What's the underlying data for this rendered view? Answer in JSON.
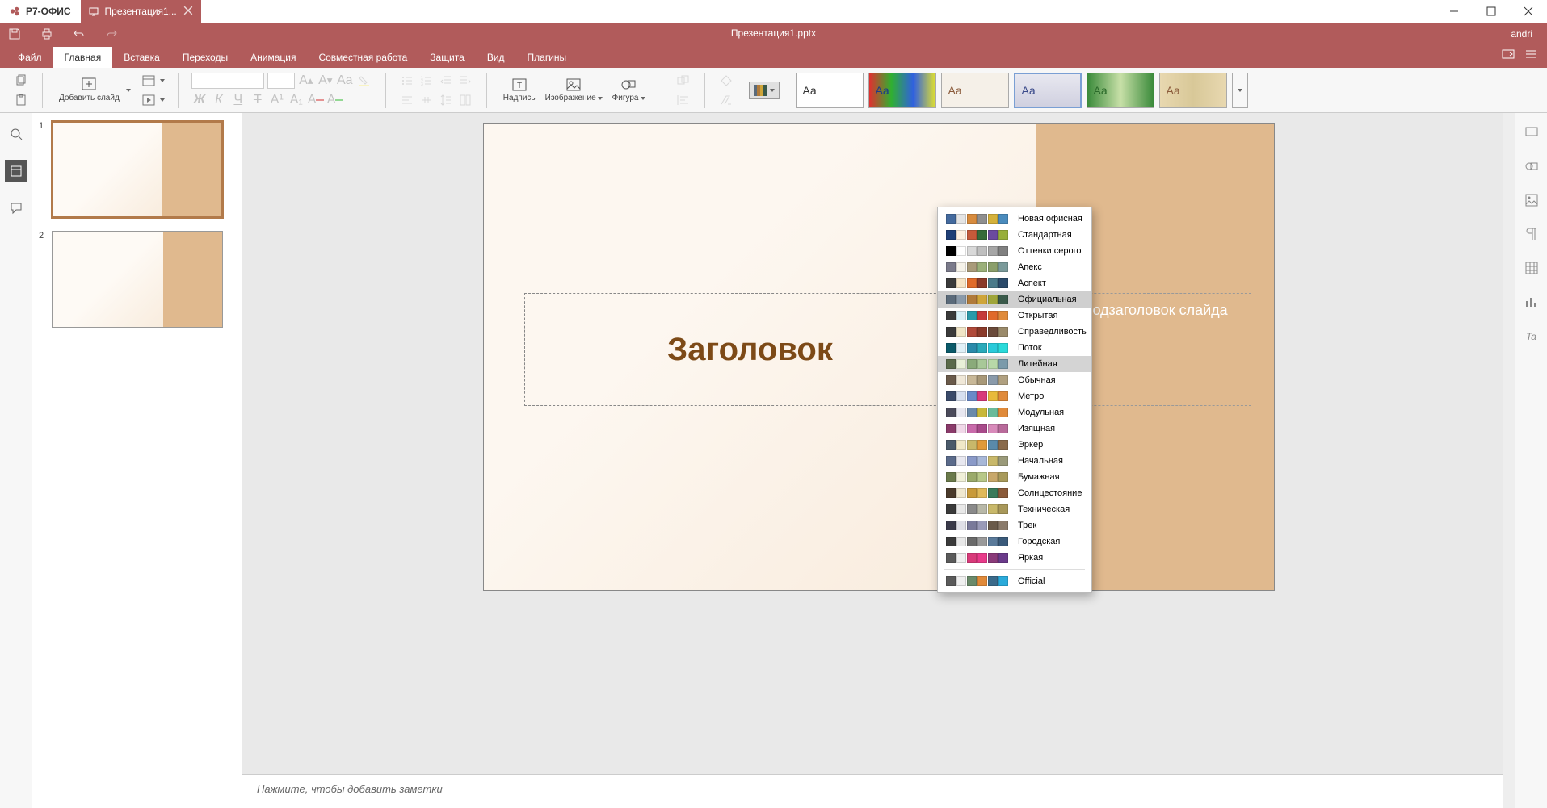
{
  "app_name": "Р7-ОФИС",
  "document_tab": "Презентация1...",
  "document_title": "Презентация1.pptx",
  "user": "andri",
  "menu": {
    "tabs": [
      "Файл",
      "Главная",
      "Вставка",
      "Переходы",
      "Анимация",
      "Совместная работа",
      "Защита",
      "Вид",
      "Плагины"
    ],
    "active_index": 1
  },
  "ribbon": {
    "add_slide": "Добавить слайд",
    "textbox": "Надпись",
    "image": "Изображение",
    "shape": "Фигура",
    "font_name": "",
    "font_size": ""
  },
  "slide_content": {
    "title": "Заголовок",
    "subtitle": "Подзаголовок слайда"
  },
  "notes_placeholder": "Нажмите, чтобы добавить заметки",
  "thumbnails": [
    {
      "num": "1"
    },
    {
      "num": "2"
    }
  ],
  "color_themes": [
    {
      "name": "Новая офисная",
      "colors": [
        "#446a9e",
        "#e4e4e4",
        "#d78b3e",
        "#8f8f8f",
        "#d4b13b",
        "#4a8bbd"
      ]
    },
    {
      "name": "Стандартная",
      "colors": [
        "#1f3f77",
        "#fff0e0",
        "#c55a3a",
        "#356a3a",
        "#6b4a9e",
        "#98af3a"
      ]
    },
    {
      "name": "Оттенки серого",
      "colors": [
        "#000000",
        "#ffffff",
        "#d9d9d9",
        "#bfbfbf",
        "#a6a6a6",
        "#808080"
      ]
    },
    {
      "name": "Апекс",
      "colors": [
        "#7a7a8a",
        "#f6f3ea",
        "#a99b7a",
        "#9bb07a",
        "#8a9e6a",
        "#7a9a9a"
      ]
    },
    {
      "name": "Аспект",
      "colors": [
        "#3a3a3a",
        "#f7e5c7",
        "#e06a2a",
        "#8a3a2a",
        "#4a7a8a",
        "#2a4a6a"
      ]
    },
    {
      "name": "Официальная",
      "colors": [
        "#5a6a7a",
        "#8a9aaa",
        "#b07a3a",
        "#cfa53a",
        "#9fa53a",
        "#3a5a4a"
      ],
      "selected": true
    },
    {
      "name": "Открытая",
      "colors": [
        "#3a3a3a",
        "#d7f0f7",
        "#2a9aaa",
        "#c53a3a",
        "#e06a2a",
        "#e08a3a"
      ]
    },
    {
      "name": "Справедливость",
      "colors": [
        "#3a3a3a",
        "#f0e5c7",
        "#b04a3a",
        "#8a3a2a",
        "#6a4a3a",
        "#9a8a6a"
      ]
    },
    {
      "name": "Поток",
      "colors": [
        "#0a5a6a",
        "#e0f0f7",
        "#2a8aaa",
        "#2aaaba",
        "#2acada",
        "#2adada"
      ]
    },
    {
      "name": "Литейная",
      "colors": [
        "#5a6a4a",
        "#e8f0d8",
        "#8aaa7a",
        "#a8c898",
        "#b8d8a8",
        "#7a9aaa"
      ],
      "hover": true
    },
    {
      "name": "Обычная",
      "colors": [
        "#6a5a4a",
        "#f0e8d8",
        "#c8b898",
        "#a89878",
        "#8a9aaa",
        "#b0a080"
      ]
    },
    {
      "name": "Метро",
      "colors": [
        "#3a4a6a",
        "#d8e0f0",
        "#6a8ac8",
        "#d83a7a",
        "#e8ba3a",
        "#e08a3a"
      ]
    },
    {
      "name": "Модульная",
      "colors": [
        "#4a4a5a",
        "#e8e8f0",
        "#6a8aaa",
        "#c8b83a",
        "#6aba9a",
        "#e08a3a"
      ]
    },
    {
      "name": "Изящная",
      "colors": [
        "#8a3a6a",
        "#f0d8e8",
        "#c86aaa",
        "#a84a8a",
        "#d88aba",
        "#b86a9a"
      ]
    },
    {
      "name": "Эркер",
      "colors": [
        "#4a5a6a",
        "#f0e8c8",
        "#c8b86a",
        "#e09a3a",
        "#5a8aaa",
        "#8a6a4a"
      ]
    },
    {
      "name": "Начальная",
      "colors": [
        "#5a6a8a",
        "#e8e8f0",
        "#8a9ac8",
        "#a8b8d8",
        "#c8b86a",
        "#9a9a7a"
      ]
    },
    {
      "name": "Бумажная",
      "colors": [
        "#6a7a4a",
        "#f0f0d8",
        "#9aaa6a",
        "#b8c888",
        "#c8a86a",
        "#a89a5a"
      ]
    },
    {
      "name": "Солнцестояние",
      "colors": [
        "#4a3a2a",
        "#f0e8d0",
        "#c89a3a",
        "#e0ba5a",
        "#3a7a5a",
        "#8a5a3a"
      ]
    },
    {
      "name": "Техническая",
      "colors": [
        "#3a3a3a",
        "#e8e8e8",
        "#8a8a8a",
        "#b8b8a8",
        "#c8b86a",
        "#a8985a"
      ]
    },
    {
      "name": "Трек",
      "colors": [
        "#3a3a4a",
        "#e0e0e8",
        "#7a7a9a",
        "#9a9ab8",
        "#6a5a4a",
        "#8a7a6a"
      ]
    },
    {
      "name": "Городская",
      "colors": [
        "#3a3a3a",
        "#e8e8e8",
        "#6a6a6a",
        "#9a9a9a",
        "#5a7a9a",
        "#3a5a7a"
      ]
    },
    {
      "name": "Яркая",
      "colors": [
        "#5a5a5a",
        "#f0f0f0",
        "#d83a7a",
        "#e83a8a",
        "#8a3a7a",
        "#6a3a8a"
      ]
    },
    {
      "name": "__sep__"
    },
    {
      "name": "Official",
      "colors": [
        "#5a5a5a",
        "#f0f0f0",
        "#6a8a6a",
        "#e08a3a",
        "#3a6a8a",
        "#2aaada"
      ]
    }
  ],
  "theme_thumbs": [
    {
      "style": "background:#fff;",
      "aa_color": "#333"
    },
    {
      "style": "background:linear-gradient(90deg,#e03030,#30b030,#3060e0,#e0e030);",
      "aa_color": "#1a3a8a"
    },
    {
      "style": "background:#f5f0e8;",
      "aa_color": "#8a5a3a"
    },
    {
      "style": "background:linear-gradient(#e8e8f0,#d0d0e0);",
      "aa_color": "#3a4a8a",
      "active": true
    },
    {
      "style": "background:linear-gradient(90deg,#3a8a3a,#c8e0a8,#3a8a3a);",
      "aa_color": "#2a6a2a"
    },
    {
      "style": "background:linear-gradient(90deg,#e8d8b0,#d8c898,#e8d8b0);",
      "aa_color": "#8a5a3a"
    }
  ]
}
